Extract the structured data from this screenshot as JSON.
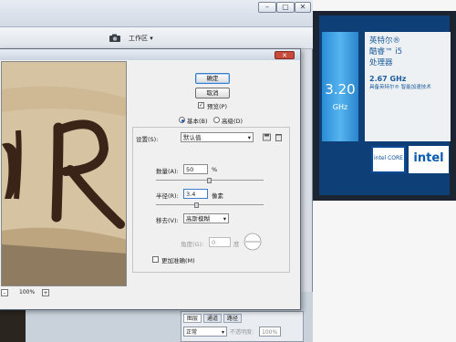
{
  "app": {
    "workspace_label": "工作区 ▾",
    "window_buttons": {
      "minimize": "–",
      "restore": "▢",
      "close": "✕"
    }
  },
  "dialog": {
    "close_glyph": "✕",
    "ok_label": "确定",
    "cancel_label": "取消",
    "preview_label": "预览(P)",
    "mode_basic_label": "基本(B)",
    "mode_advanced_label": "高级(D)",
    "preview_zoom": "100%",
    "settings": {
      "label": "设置(S):",
      "value": "默认值"
    },
    "amount": {
      "label": "数量(A):",
      "value": "50",
      "unit": "%",
      "level": 0.5
    },
    "radius": {
      "label": "半径(R):",
      "value": "3.4",
      "unit": "像素",
      "level": 0.38
    },
    "remove": {
      "label": "移去(V):",
      "value": "高斯模糊"
    },
    "angle": {
      "label": "角度(G):",
      "value": "0",
      "unit": "度"
    },
    "more_accurate_label": "更加准确(M)",
    "preview_image_text": "R"
  },
  "layers_panel": {
    "tabs": [
      "图层",
      "通道",
      "路径"
    ],
    "blend_mode": "正常",
    "opacity_label": "不透明度:",
    "opacity_value": "100%"
  },
  "cpu_label": {
    "brand_line": "英特尔®",
    "model_line": "酷睿™ i5",
    "type_line": "处理器",
    "freq_ghz_text": "2.67 GHz",
    "tech_line": "具备英特尔® 智能加速技术",
    "big_freq": "3.20",
    "big_unit": "GHz",
    "badge_text": "intel CORE",
    "logo_text": "intel",
    "colors": {
      "blue": "#0f3f77",
      "accent": "#56b4ef"
    }
  }
}
